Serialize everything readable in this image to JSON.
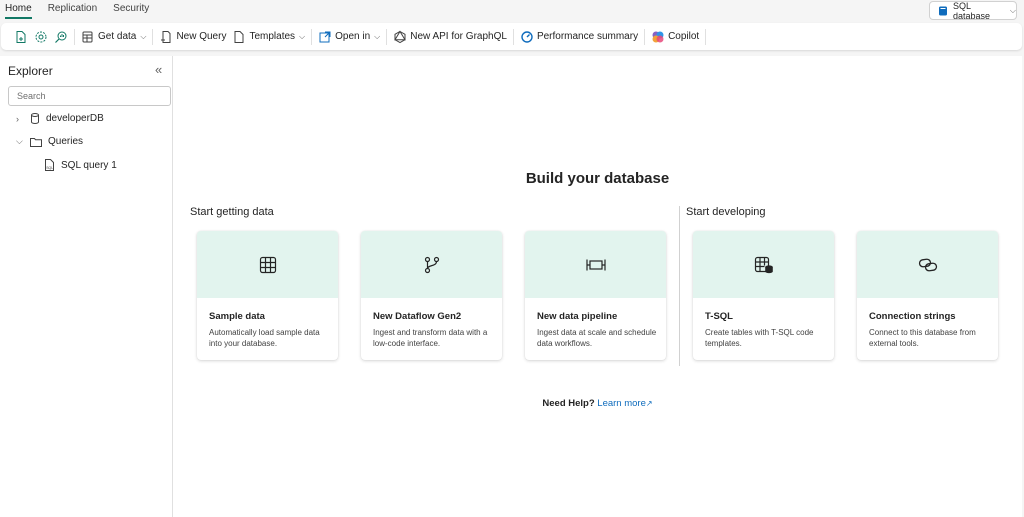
{
  "top_tabs": [
    "Home",
    "Replication",
    "Security"
  ],
  "db_switch": {
    "label": "SQL database"
  },
  "ribbon": {
    "get_data": "Get data",
    "new_query": "New Query",
    "templates": "Templates",
    "open_in": "Open in",
    "new_api": "New API for GraphQL",
    "perf_summary": "Performance summary",
    "copilot": "Copilot"
  },
  "explorer": {
    "title": "Explorer",
    "search_placeholder": "Search",
    "items": [
      {
        "label": "developerDB"
      },
      {
        "label": "Queries"
      },
      {
        "label": "SQL query 1"
      }
    ]
  },
  "main": {
    "heading": "Build your database",
    "section_getting": "Start getting data",
    "section_developing": "Start developing",
    "cards": [
      {
        "icon": "table-grid-icon",
        "title": "Sample data",
        "desc": "Automatically load sample data into your database."
      },
      {
        "icon": "dataflow-branch-icon",
        "title": "New Dataflow Gen2",
        "desc": "Ingest and transform data with a low-code interface."
      },
      {
        "icon": "pipeline-icon",
        "title": "New data pipeline",
        "desc": "Ingest data at scale and schedule data workflows."
      },
      {
        "icon": "tsql-table-icon",
        "title": "T-SQL",
        "desc": "Create tables with T-SQL code templates."
      },
      {
        "icon": "link-chain-icon",
        "title": "Connection strings",
        "desc": "Connect to this database from external tools."
      }
    ],
    "help_label": "Need Help?",
    "help_link": "Learn more"
  },
  "colors": {
    "accent": "#117865",
    "card_top": "#e2f4ee",
    "link": "#0f6cbd"
  }
}
